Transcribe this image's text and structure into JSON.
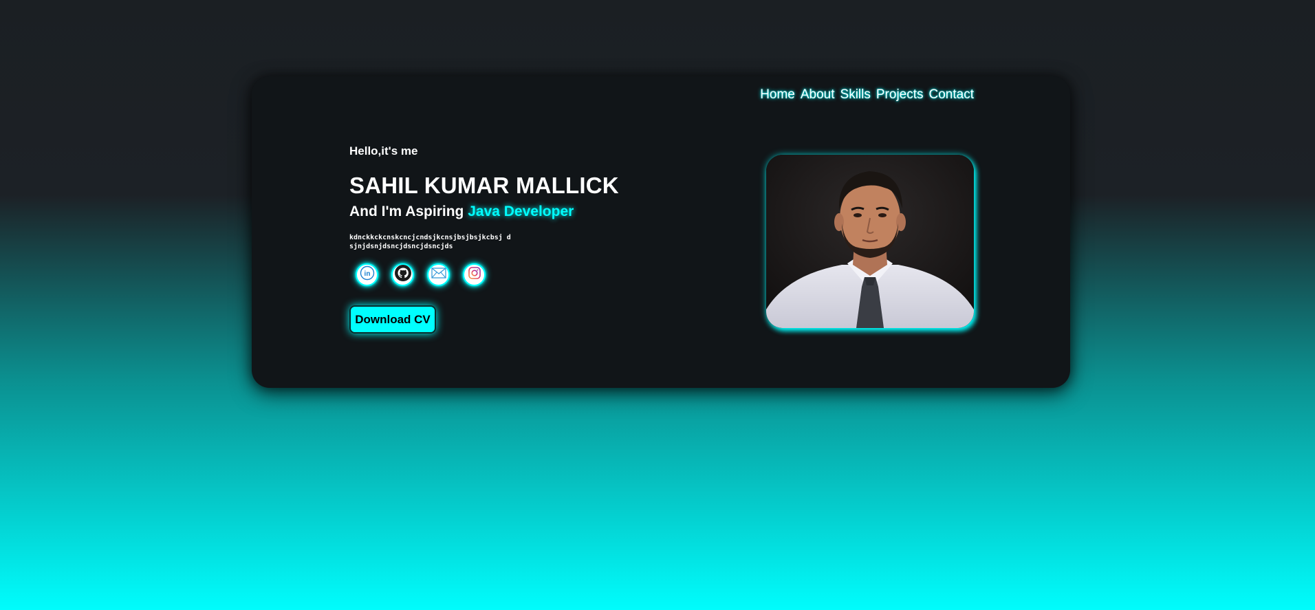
{
  "nav": {
    "items": [
      "Home",
      "About",
      "Skills",
      "Projects",
      "Contact"
    ]
  },
  "hero": {
    "greeting": "Hello,it's me",
    "name": "SAHIL KUMAR MALLICK",
    "role_prefix": "And I'm Aspiring ",
    "role_highlight": "Java Developer",
    "description": "kdnckkckcnskcncjcndsjkcnsjbsjbsjkcbsj dsjnjdsnjdsncjdsncjdsncjds",
    "cta_label": "Download CV"
  },
  "socials": [
    {
      "icon": "linkedin-icon"
    },
    {
      "icon": "github-icon"
    },
    {
      "icon": "mail-icon"
    },
    {
      "icon": "instagram-icon"
    }
  ],
  "colors": {
    "accent": "#00ffff",
    "card": "#111518",
    "background_top": "#1b1f23",
    "background_bottom": "#00fdfd"
  }
}
